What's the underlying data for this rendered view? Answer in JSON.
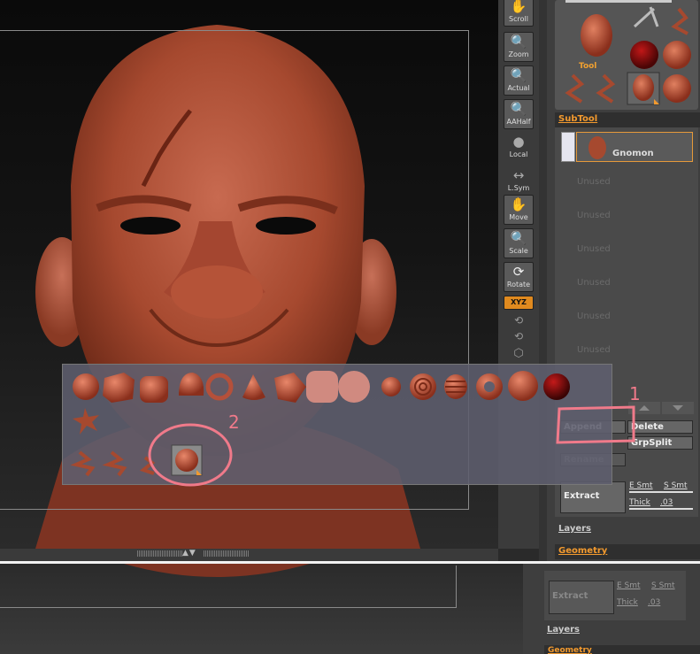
{
  "toolbar": {
    "buttons": [
      {
        "label": "Scroll",
        "icon": "hand-icon"
      },
      {
        "label": "Zoom",
        "icon": "magnifier-icon"
      },
      {
        "label": "Actual",
        "icon": "magnifier-icon"
      },
      {
        "label": "AAHalf",
        "icon": "magnifier-icon"
      },
      {
        "label": "Local",
        "icon": "sphere-icon"
      },
      {
        "label": "L.Sym",
        "icon": "symmetry-icon"
      },
      {
        "label": "Move",
        "icon": "hand-icon"
      },
      {
        "label": "Scale",
        "icon": "magnifier-icon"
      },
      {
        "label": "Rotate",
        "icon": "rotate-icon"
      },
      {
        "label": "XYZ",
        "icon": "xyz-icon"
      }
    ]
  },
  "tool_panel": {
    "current_tool_label": "Tool"
  },
  "subtool": {
    "header": "SubTool",
    "active_name": "Gnomon",
    "slots": [
      "Unused",
      "Unused",
      "Unused",
      "Unused",
      "Unused",
      "Unused"
    ],
    "append_label": "Append",
    "delete_label": "Delete",
    "grpsplit_label": "GrpSplit",
    "rename_label": "Rename",
    "extract_label": "Extract",
    "e_smt_label": "E Smt",
    "s_smt_label": "S Smt",
    "thick_label": "Thick",
    "thick_value": ".03"
  },
  "sections": {
    "layers": "Layers",
    "geometry": "Geometry"
  },
  "lower_panel": {
    "extract_label": "Extract",
    "e_smt_label": "E Smt",
    "s_smt_label": "S Smt",
    "thick_label": "Thick",
    "thick_value": ".03",
    "layers": "Layers",
    "geometry": "Geometry"
  },
  "annotations": {
    "mark_1": "1",
    "mark_2": "2"
  },
  "colors": {
    "accent_orange": "#f39a2e",
    "clay": "#b5503a",
    "annotation_pink": "#f07a8a"
  }
}
